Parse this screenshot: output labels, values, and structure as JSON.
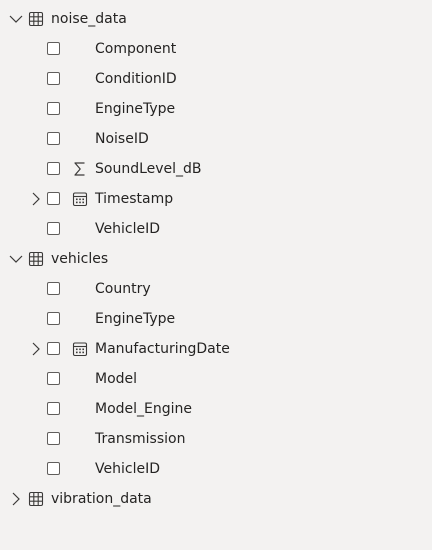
{
  "tables": [
    {
      "name": "noise_data",
      "expanded": true,
      "fields": [
        {
          "label": "Component",
          "type": "text",
          "expandable": false
        },
        {
          "label": "ConditionID",
          "type": "text",
          "expandable": false
        },
        {
          "label": "EngineType",
          "type": "text",
          "expandable": false
        },
        {
          "label": "NoiseID",
          "type": "text",
          "expandable": false
        },
        {
          "label": "SoundLevel_dB",
          "type": "sum",
          "expandable": false
        },
        {
          "label": "Timestamp",
          "type": "date",
          "expandable": true
        },
        {
          "label": "VehicleID",
          "type": "text",
          "expandable": false
        }
      ]
    },
    {
      "name": "vehicles",
      "expanded": true,
      "fields": [
        {
          "label": "Country",
          "type": "text",
          "expandable": false
        },
        {
          "label": "EngineType",
          "type": "text",
          "expandable": false
        },
        {
          "label": "ManufacturingDate",
          "type": "date",
          "expandable": true
        },
        {
          "label": "Model",
          "type": "text",
          "expandable": false
        },
        {
          "label": "Model_Engine",
          "type": "text",
          "expandable": false
        },
        {
          "label": "Transmission",
          "type": "text",
          "expandable": false
        },
        {
          "label": "VehicleID",
          "type": "text",
          "expandable": false
        }
      ]
    },
    {
      "name": "vibration_data",
      "expanded": false,
      "fields": []
    }
  ]
}
